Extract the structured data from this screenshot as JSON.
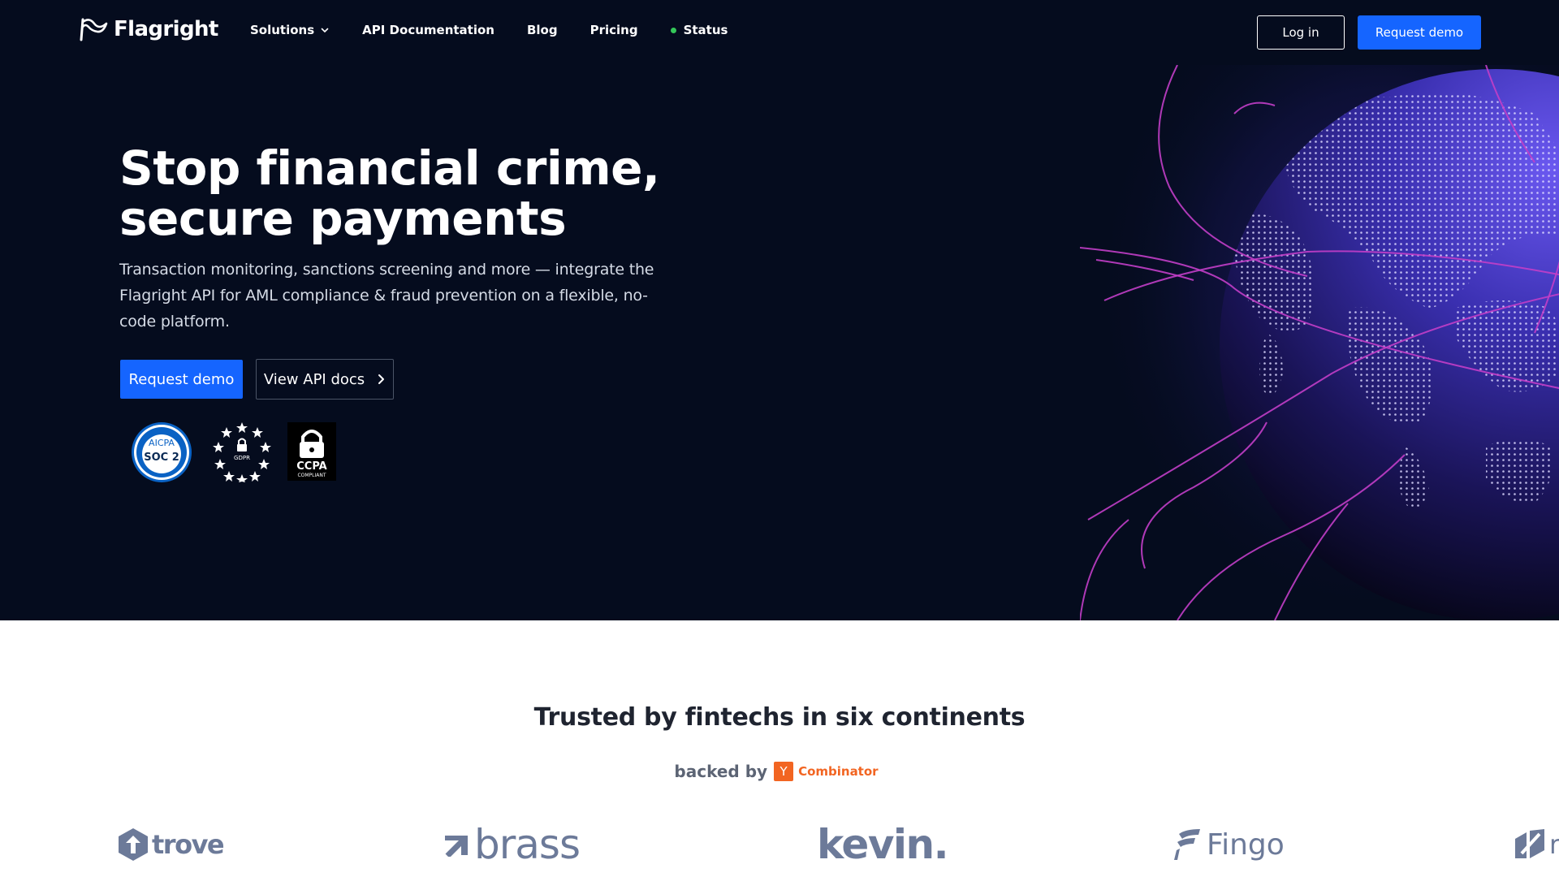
{
  "nav": {
    "brand": "Flagright",
    "links": [
      {
        "label": "Solutions"
      },
      {
        "label": "API Documentation"
      },
      {
        "label": "Blog"
      },
      {
        "label": "Pricing"
      },
      {
        "label": "Status"
      }
    ],
    "login_label": "Log in",
    "demo_label": "Request demo"
  },
  "hero": {
    "title_line1": "Stop financial crime,",
    "title_line2": "secure payments",
    "subtitle": "Transaction monitoring, sanctions screening and more — integrate the Flagright API for AML compliance & fraud prevention on a flexible, no-code platform.",
    "primary_button": "Request demo",
    "secondary_button": "View API docs",
    "badges": {
      "soc_top": "AICPA",
      "soc_main": "SOC 2",
      "gdpr": "GDPR",
      "ccpa_main": "CCPA",
      "ccpa_sub": "COMPLIANT"
    }
  },
  "trusted": {
    "title": "Trusted by fintechs in six continents",
    "backed_label": "backed by",
    "yc_letter": "Y",
    "yc_name": "Combinator"
  },
  "partners": [
    "trove",
    "brass",
    "kevin.",
    "Fingo",
    "r"
  ],
  "colors": {
    "hero_bg": "#050c1e",
    "accent": "#1565ff",
    "status_green": "#34c759",
    "yc_orange": "#f26522",
    "partner_gray": "#6c7a99"
  },
  "icons": [
    "flagright-logo-icon",
    "chevron-down-icon",
    "status-dot-icon",
    "chevron-right-icon",
    "globe-graphic"
  ]
}
